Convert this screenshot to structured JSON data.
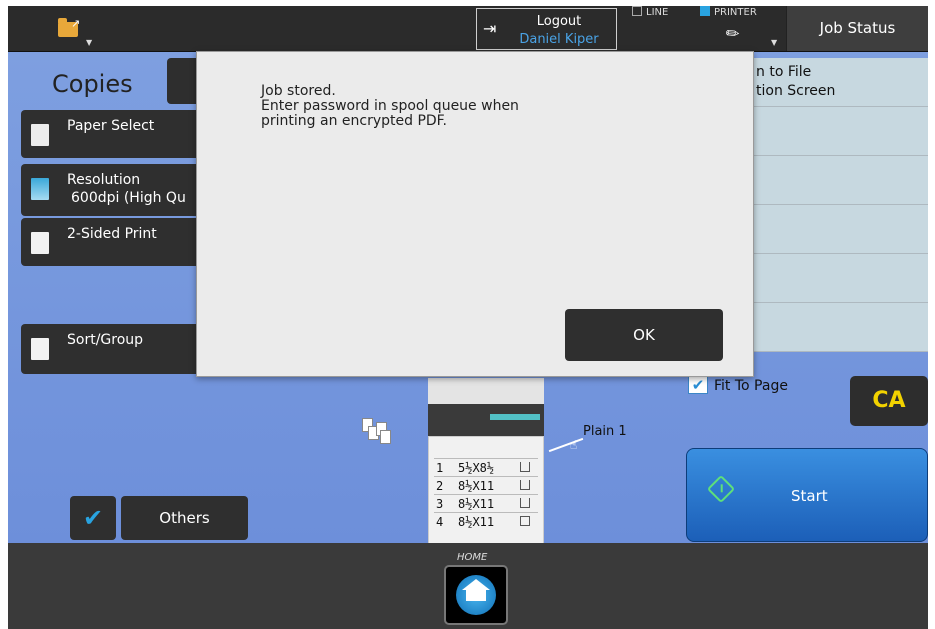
{
  "topbar": {
    "logout_label": "Logout",
    "user_name": "Daniel Kiper",
    "mode_line": "LINE",
    "mode_printer": "PRINTER",
    "job_status": "Job Status"
  },
  "main": {
    "title": "Copies",
    "left_buttons": [
      {
        "label": "Paper Select",
        "sub": ""
      },
      {
        "label": "Resolution",
        "sub": "600dpi (High Qu"
      },
      {
        "label": "2-Sided Print",
        "sub": ""
      },
      {
        "label": "Sort/Group",
        "sub": ""
      }
    ],
    "others_label": "Others",
    "right_panel": {
      "line1": "n to File",
      "line2": "tion Screen"
    },
    "fit_to_page": {
      "label": "Fit To Page",
      "checked": true
    },
    "ca_label": "CA",
    "start_label": "Start",
    "paper_source_label": "Plain 1",
    "trays": [
      {
        "num": "1",
        "size": "5½X8½"
      },
      {
        "num": "2",
        "size": "8½X11"
      },
      {
        "num": "3",
        "size": "8½X11"
      },
      {
        "num": "4",
        "size": "8½X11"
      }
    ]
  },
  "bottom": {
    "home_label": "HOME"
  },
  "dialog": {
    "message_lines": [
      "Job stored.",
      "Enter password in spool queue when",
      "printing an encrypted PDF."
    ],
    "ok_label": "OK"
  },
  "colors": {
    "accent_blue": "#29a3e0",
    "start_green": "#5ee07a",
    "ca_yellow": "#f2d200",
    "main_background": "#7e9fe0"
  },
  "icons": {
    "folder": "folder-icon",
    "logout": "logout-icon",
    "printer": "printer-icon",
    "home": "home-icon",
    "start": "start-icon",
    "checkmark": "checkmark-icon"
  }
}
